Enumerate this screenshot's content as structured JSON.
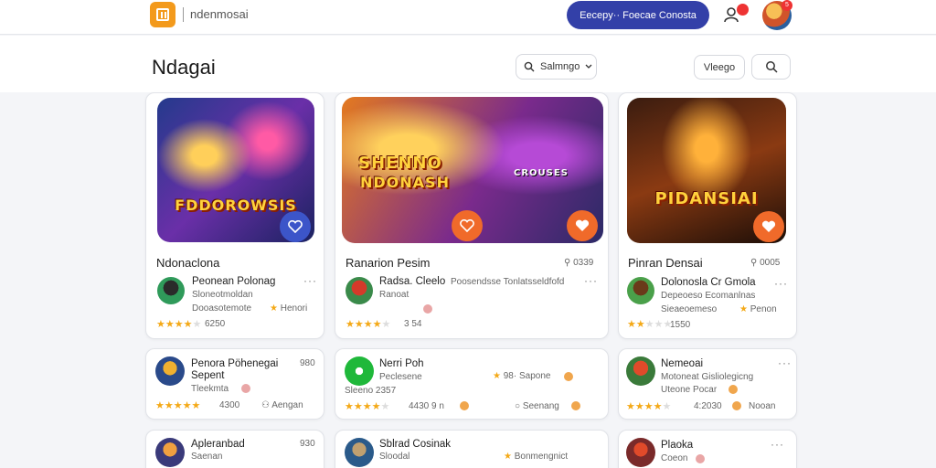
{
  "topbar": {
    "app_name": "ndenmosai",
    "primary_button": "Eecepy·· Foecae Conosta",
    "notification_count": "",
    "avatar_badge": "5"
  },
  "header": {
    "title": "Ndagai",
    "sort_label": "Salmngo",
    "ghost_button": "Vleego"
  },
  "featured": [
    {
      "hero_text_1": "FDDOROWSIS",
      "hero_text_2": "",
      "title": "Ndonaclona",
      "meta": "",
      "user": "Peonean Polonag",
      "line2": "Sloneotmoldan",
      "line3": "Dooasotemote",
      "tag": "Henori",
      "rating_text": "6250",
      "stars": 4
    },
    {
      "hero_text_1": "SHENNO",
      "hero_text_2": "NDONASH",
      "hero_text_3": "CROUSES",
      "title": "Ranarion Pesim",
      "meta": "0339",
      "user": "Radsa. Cleelo",
      "line2": "Poosendsse Tonlatsseldfofd",
      "line2b": "Ranoat",
      "line3": "",
      "tag": "",
      "rating_text": "3 54",
      "stars": 4
    },
    {
      "hero_text_1": "PIDANSIAI",
      "title": "Pinran Densai",
      "meta": "0005",
      "user": "Dolonosla Cr Gmola",
      "line2": "Depeoeso Ecomanlnas",
      "line3": "Sieaeoemeso",
      "tag": "Penon",
      "rating_text": "1550",
      "stars": 2
    }
  ],
  "list": [
    {
      "name": "Penora Pöhenegai",
      "name2": "Sepent",
      "sub": "Tleekmta",
      "meta": "980",
      "rating": "4300",
      "tag": "Aengan",
      "stars": 5
    },
    {
      "name": "Nerri Poh",
      "name2": "Peclesene",
      "sub": "Sleeno 2357",
      "meta": "98· Sapone",
      "rating": "4430 9 n",
      "tag": "Seenang",
      "stars": 4
    },
    {
      "name": "Nemeoai",
      "name2": "Motoneat Gisliolegicng",
      "sub": "Uteone Pocar",
      "meta": "",
      "rating": "4:2030",
      "tag": "Nooan",
      "stars": 4
    },
    {
      "name": "Apleranbad",
      "name2": "Saenan",
      "sub": "",
      "meta": "930",
      "rating": "",
      "tag": "",
      "stars": 0
    },
    {
      "name": "Sblrad Cosinak",
      "name2": "Sloodal",
      "sub": "",
      "meta": "Bonmengnict",
      "rating": "",
      "tag": "",
      "stars": 0
    },
    {
      "name": "Plaoka",
      "name2": "Coeon",
      "sub": "",
      "meta": "",
      "rating": "",
      "tag": "",
      "stars": 0
    }
  ]
}
